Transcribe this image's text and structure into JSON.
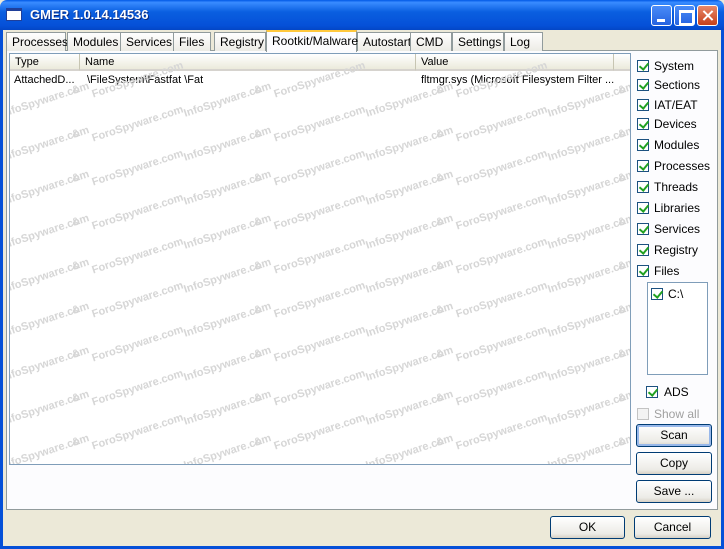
{
  "window": {
    "title": "GMER 1.0.14.14536"
  },
  "tabs": [
    {
      "label": "Processes"
    },
    {
      "label": "Modules"
    },
    {
      "label": "Services"
    },
    {
      "label": "Files"
    },
    {
      "label": "Registry"
    },
    {
      "label": "Rootkit/Malware",
      "active": true
    },
    {
      "label": "Autostart"
    },
    {
      "label": "CMD"
    },
    {
      "label": "Settings"
    },
    {
      "label": "Log"
    }
  ],
  "list": {
    "columns": [
      "Type",
      "Name",
      "Value"
    ],
    "rows": [
      {
        "type": "AttachedD...",
        "name": "\\FileSystem\\Fastfat \\Fat",
        "value": "fltmgr.sys (Microsoft Filesystem Filter ..."
      }
    ]
  },
  "watermark": {
    "text_a": "InfoSpyware.com",
    "text_b": "&",
    "text_c": "ForoSpyware.com"
  },
  "options": {
    "system": "System",
    "sections": "Sections",
    "iat_eat": "IAT/EAT",
    "devices": "Devices",
    "modules": "Modules",
    "processes": "Processes",
    "threads": "Threads",
    "libraries": "Libraries",
    "services": "Services",
    "registry": "Registry",
    "files": "Files",
    "drive_c": "C:\\",
    "ads": "ADS",
    "showall": "Show all"
  },
  "buttons": {
    "scan": "Scan",
    "copy": "Copy",
    "save": "Save ...",
    "ok": "OK",
    "cancel": "Cancel"
  }
}
